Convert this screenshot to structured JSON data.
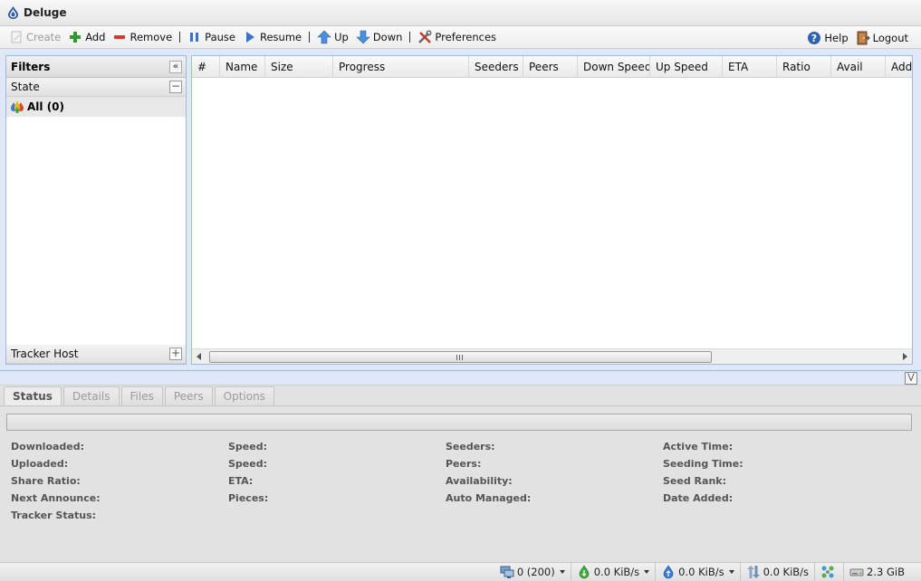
{
  "app": {
    "title": "Deluge"
  },
  "toolbar": {
    "create": "Create",
    "add": "Add",
    "remove": "Remove",
    "pause": "Pause",
    "resume": "Resume",
    "up": "Up",
    "down": "Down",
    "preferences": "Preferences",
    "help": "Help",
    "logout": "Logout"
  },
  "filters": {
    "title": "Filters",
    "state_label": "State",
    "state_items": [
      {
        "label": "All (0)"
      }
    ],
    "tracker_label": "Tracker Host"
  },
  "torrents": {
    "columns": [
      "#",
      "Name",
      "Size",
      "Progress",
      "Seeders",
      "Peers",
      "Down Speed",
      "Up Speed",
      "ETA",
      "Ratio",
      "Avail",
      "Added"
    ]
  },
  "details": {
    "tabs": [
      "Status",
      "Details",
      "Files",
      "Peers",
      "Options"
    ],
    "active_tab": "Status",
    "fields": [
      [
        "Downloaded:",
        "Uploaded:",
        "Share Ratio:",
        "Next Announce:",
        "Tracker Status:"
      ],
      [
        "Speed:",
        "Speed:",
        "ETA:",
        "Pieces:"
      ],
      [
        "Seeders:",
        "Peers:",
        "Availability:",
        "Auto Managed:"
      ],
      [
        "Active Time:",
        "Seeding Time:",
        "Seed Rank:",
        "Date Added:"
      ]
    ]
  },
  "statusbar": {
    "connections": "0 (200)",
    "down_speed": "0.0 KiB/s",
    "up_speed": "0.0 KiB/s",
    "traffic": "0.0 KiB/s",
    "free_space": "2.3 GiB"
  },
  "colors": {
    "panel_border": "#99bbe8",
    "background": "#dfe8f6"
  }
}
